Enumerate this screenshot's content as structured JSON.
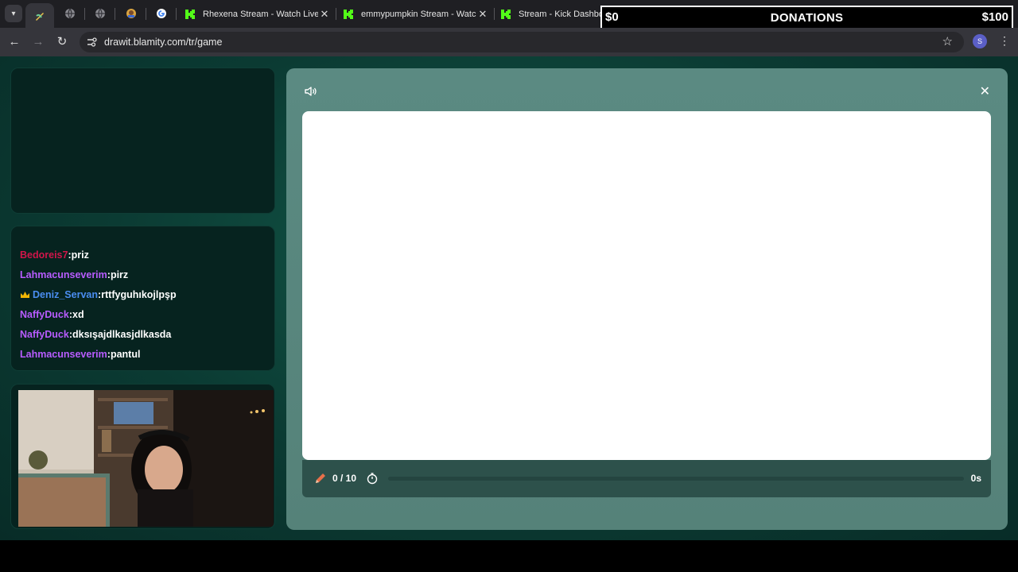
{
  "browser": {
    "tabs": [
      {
        "title": "Rhexena Stream - Watch Live on Kick"
      },
      {
        "title": "emmypumpkin Stream - Watch Live on Kick"
      },
      {
        "title": "Stream - Kick Dashboard"
      }
    ],
    "close_glyph": "✕",
    "new_tab_glyph": "+",
    "url": "drawit.blamity.com/tr/game",
    "profile_initial": "S",
    "accent": "#53fc18"
  },
  "donations": {
    "title": "DONATIONS",
    "min": "$0",
    "max": "$100"
  },
  "chat": {
    "messages": [
      {
        "user": "Bedoreis7",
        "color": "#d0154a",
        "text": ":priz",
        "crown": false
      },
      {
        "user": "Lahmacunseverim",
        "color": "#b85cff",
        "text": ":pirz",
        "crown": false
      },
      {
        "user": "Deniz_Servan",
        "color": "#4a8df0",
        "text": ":rttfyguhıkojlpşp",
        "crown": true
      },
      {
        "user": "NaffyDuck",
        "color": "#b85cff",
        "text": ":xd",
        "crown": false
      },
      {
        "user": "NaffyDuck",
        "color": "#b85cff",
        "text": ":dksışajdlkasjdlkasda",
        "crown": false
      },
      {
        "user": "Lahmacunseverim",
        "color": "#b85cff",
        "text": ":pantul",
        "crown": false
      }
    ]
  },
  "game": {
    "close_glyph": "✕",
    "rounds": "0 / 10",
    "timer": "0s",
    "progress": 0
  }
}
